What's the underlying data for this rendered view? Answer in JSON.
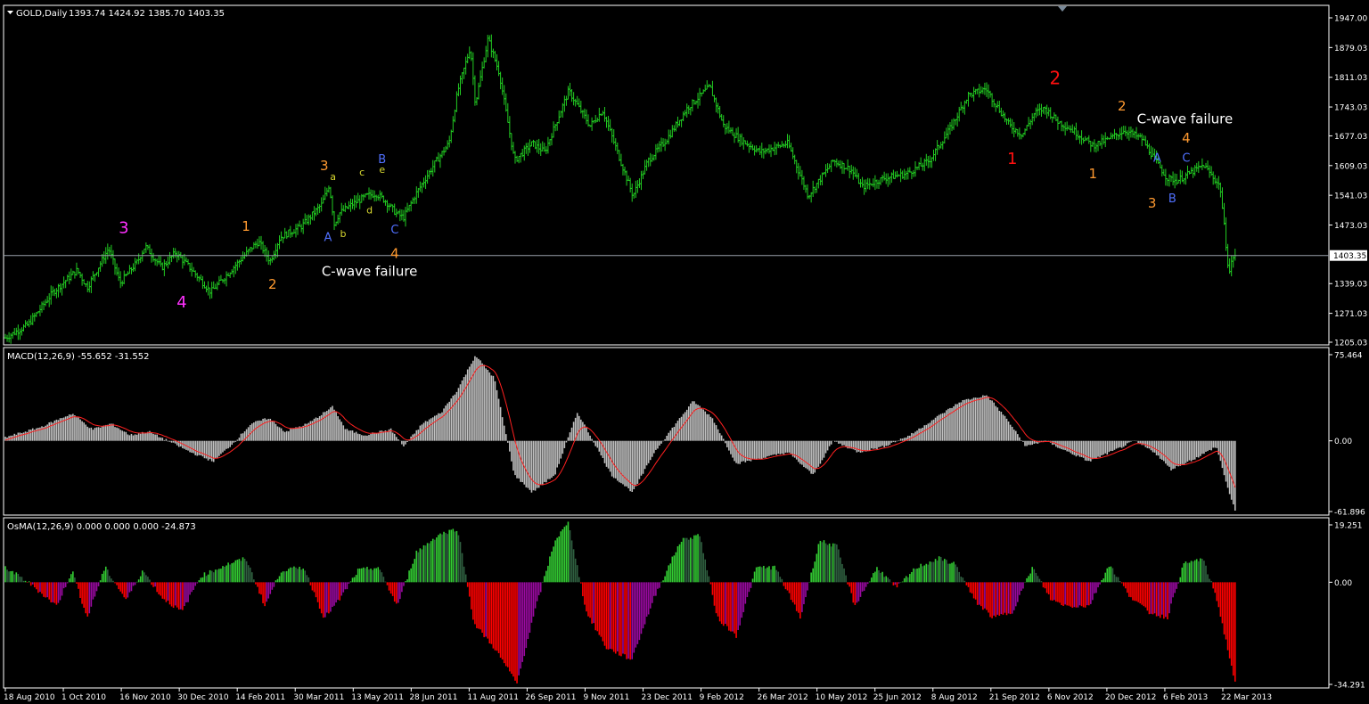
{
  "header": {
    "symbol": "GOLD,Daily",
    "ohlc": "1393.74 1424.92 1385.70 1403.35"
  },
  "colors": {
    "background": "#000000",
    "frame": "#ffffff",
    "bull_bar": "#22cc22",
    "macd_hist": "#c0c0c0",
    "macd_signal": "#ff2020",
    "osma_up_bright": "#33cc33",
    "osma_up_dark": "#2f6040",
    "osma_down_red": "#ff0000",
    "osma_down_purple": "#9a0aa0",
    "price_line": "#9aa0aa",
    "wave_magenta": "#ff30ff",
    "wave_orange": "#ff9a30",
    "wave_blue": "#5070ff",
    "wave_yellow": "#d8d830",
    "wave_red": "#ff1010",
    "annotation_text": "#ffffff"
  },
  "chart_data": [
    {
      "type": "bar",
      "subtype": "ohlc",
      "title": "GOLD,Daily",
      "ohlc_readout": {
        "open": 1393.74,
        "high": 1424.92,
        "low": 1385.7,
        "close": 1403.35
      },
      "current_price": 1403.35,
      "current_price_label": "1403.35",
      "ylim": [
        1205.0,
        1947.0
      ],
      "y_ticks": [
        "1947.00",
        "1879.03",
        "1811.03",
        "1743.03",
        "1677.03",
        "1609.03",
        "1541.03",
        "1473.03",
        "1339.03",
        "1271.03",
        "1205.03"
      ],
      "x_ticks": [
        "18 Aug 2010",
        "1 Oct 2010",
        "16 Nov 2010",
        "30 Dec 2010",
        "14 Feb 2011",
        "30 Mar 2011",
        "13 May 2011",
        "28 Jun 2011",
        "11 Aug 2011",
        "26 Sep 2011",
        "9 Nov 2011",
        "23 Dec 2011",
        "9 Feb 2012",
        "26 Mar 2012",
        "10 May 2012",
        "25 Jun 2012",
        "8 Aug 2012",
        "21 Sep 2012",
        "6 Nov 2012",
        "20 Dec 2012",
        "6 Feb 2013",
        "22 Mar 2013"
      ],
      "price_path": [
        [
          "2010-08-18",
          1215
        ],
        [
          "2010-09-05",
          1245
        ],
        [
          "2010-09-25",
          1320
        ],
        [
          "2010-10-14",
          1370
        ],
        [
          "2010-10-22",
          1330
        ],
        [
          "2010-11-08",
          1420
        ],
        [
          "2010-11-17",
          1340
        ],
        [
          "2010-12-01",
          1390
        ],
        [
          "2010-12-07",
          1425
        ],
        [
          "2010-12-20",
          1375
        ],
        [
          "2010-12-31",
          1410
        ],
        [
          "2011-01-10",
          1380
        ],
        [
          "2011-01-28",
          1320
        ],
        [
          "2011-02-10",
          1360
        ],
        [
          "2011-03-01",
          1420
        ],
        [
          "2011-03-07",
          1435
        ],
        [
          "2011-03-16",
          1390
        ],
        [
          "2011-03-24",
          1445
        ],
        [
          "2011-04-10",
          1470
        ],
        [
          "2011-04-26",
          1520
        ],
        [
          "2011-05-02",
          1565
        ],
        [
          "2011-05-06",
          1475
        ],
        [
          "2011-05-10",
          1500
        ],
        [
          "2011-05-20",
          1520
        ],
        [
          "2011-06-01",
          1540
        ],
        [
          "2011-06-08",
          1545
        ],
        [
          "2011-06-15",
          1530
        ],
        [
          "2011-06-24",
          1500
        ],
        [
          "2011-06-30",
          1490
        ],
        [
          "2011-07-10",
          1545
        ],
        [
          "2011-07-25",
          1615
        ],
        [
          "2011-08-05",
          1660
        ],
        [
          "2011-08-12",
          1780
        ],
        [
          "2011-08-22",
          1880
        ],
        [
          "2011-08-26",
          1750
        ],
        [
          "2011-09-05",
          1900
        ],
        [
          "2011-09-14",
          1820
        ],
        [
          "2011-09-26",
          1620
        ],
        [
          "2011-10-10",
          1660
        ],
        [
          "2011-10-20",
          1640
        ],
        [
          "2011-11-08",
          1780
        ],
        [
          "2011-11-25",
          1700
        ],
        [
          "2011-12-05",
          1735
        ],
        [
          "2011-12-29",
          1540
        ],
        [
          "2012-01-10",
          1620
        ],
        [
          "2012-01-25",
          1670
        ],
        [
          "2012-02-10",
          1740
        ],
        [
          "2012-02-28",
          1790
        ],
        [
          "2012-03-10",
          1700
        ],
        [
          "2012-03-25",
          1665
        ],
        [
          "2012-04-08",
          1640
        ],
        [
          "2012-04-30",
          1660
        ],
        [
          "2012-05-16",
          1540
        ],
        [
          "2012-06-05",
          1620
        ],
        [
          "2012-06-19",
          1600
        ],
        [
          "2012-06-28",
          1560
        ],
        [
          "2012-07-15",
          1580
        ],
        [
          "2012-08-02",
          1590
        ],
        [
          "2012-08-20",
          1620
        ],
        [
          "2012-09-05",
          1690
        ],
        [
          "2012-09-20",
          1770
        ],
        [
          "2012-10-04",
          1785
        ],
        [
          "2012-10-23",
          1700
        ],
        [
          "2012-11-02",
          1680
        ],
        [
          "2012-11-12",
          1730
        ],
        [
          "2012-11-20",
          1740
        ],
        [
          "2012-11-30",
          1710
        ],
        [
          "2012-12-12",
          1690
        ],
        [
          "2012-12-28",
          1655
        ],
        [
          "2013-01-10",
          1670
        ],
        [
          "2013-01-22",
          1690
        ],
        [
          "2013-02-05",
          1670
        ],
        [
          "2013-02-18",
          1610
        ],
        [
          "2013-02-25",
          1580
        ],
        [
          "2013-03-05",
          1575
        ],
        [
          "2013-03-20",
          1600
        ],
        [
          "2013-03-26",
          1610
        ],
        [
          "2013-04-03",
          1580
        ],
        [
          "2013-04-08",
          1560
        ],
        [
          "2013-04-15",
          1360
        ],
        [
          "2013-04-18",
          1400
        ],
        [
          "2013-04-20",
          1403
        ]
      ],
      "annotations": [
        {
          "text": "3",
          "color": "wave_magenta",
          "date": "2010-11-20",
          "price": 1455,
          "size": 18
        },
        {
          "text": "4",
          "color": "wave_magenta",
          "date": "2011-01-05",
          "price": 1285,
          "size": 18
        },
        {
          "text": "1",
          "color": "wave_orange",
          "date": "2011-02-25",
          "price": 1460,
          "size": 15
        },
        {
          "text": "2",
          "color": "wave_orange",
          "date": "2011-03-18",
          "price": 1327,
          "size": 15
        },
        {
          "text": "3",
          "color": "wave_orange",
          "date": "2011-04-28",
          "price": 1598,
          "size": 15
        },
        {
          "text": "a",
          "color": "wave_yellow",
          "date": "2011-05-05",
          "price": 1576,
          "size": 11
        },
        {
          "text": "A",
          "color": "wave_blue",
          "date": "2011-05-01",
          "price": 1436,
          "size": 13
        },
        {
          "text": "b",
          "color": "wave_yellow",
          "date": "2011-05-13",
          "price": 1446,
          "size": 11
        },
        {
          "text": "c",
          "color": "wave_yellow",
          "date": "2011-05-28",
          "price": 1586,
          "size": 11
        },
        {
          "text": "d",
          "color": "wave_yellow",
          "date": "2011-06-03",
          "price": 1500,
          "size": 11
        },
        {
          "text": "e",
          "color": "wave_yellow",
          "date": "2011-06-13",
          "price": 1592,
          "size": 11
        },
        {
          "text": "B",
          "color": "wave_blue",
          "date": "2011-06-13",
          "price": 1615,
          "size": 13
        },
        {
          "text": "C",
          "color": "wave_blue",
          "date": "2011-06-23",
          "price": 1454,
          "size": 13
        },
        {
          "text": "4",
          "color": "wave_orange",
          "date": "2011-06-23",
          "price": 1398,
          "size": 15
        },
        {
          "text": "C-wave failure",
          "color": "annotation_text",
          "date": "2011-06-03",
          "price": 1357,
          "size": 15
        },
        {
          "text": "1",
          "color": "wave_red",
          "date": "2012-10-25",
          "price": 1613,
          "size": 18
        },
        {
          "text": "2",
          "color": "wave_red",
          "date": "2012-11-28",
          "price": 1795,
          "size": 20
        },
        {
          "text": "1",
          "color": "wave_orange",
          "date": "2012-12-28",
          "price": 1580,
          "size": 15
        },
        {
          "text": "2",
          "color": "wave_orange",
          "date": "2013-01-20",
          "price": 1735,
          "size": 15
        },
        {
          "text": "A",
          "color": "wave_blue",
          "date": "2013-02-17",
          "price": 1618,
          "size": 13
        },
        {
          "text": "3",
          "color": "wave_orange",
          "date": "2013-02-13",
          "price": 1513,
          "size": 15
        },
        {
          "text": "B",
          "color": "wave_blue",
          "date": "2013-03-01",
          "price": 1525,
          "size": 13
        },
        {
          "text": "C",
          "color": "wave_blue",
          "date": "2013-03-12",
          "price": 1618,
          "size": 13
        },
        {
          "text": "4",
          "color": "wave_orange",
          "date": "2013-03-12",
          "price": 1662,
          "size": 15
        },
        {
          "text": "C-wave failure",
          "color": "annotation_text",
          "date": "2013-03-11",
          "price": 1705,
          "size": 15
        }
      ]
    },
    {
      "type": "bar",
      "title": "MACD(12,26,9) -55.652 -31.552",
      "params": "12,26,9",
      "last_main": -55.652,
      "last_signal": -31.552,
      "ylim": [
        -61.896,
        75.464
      ],
      "y_ticks": [
        "75.464",
        "0.00",
        "-61.896"
      ],
      "histogram_path": [
        [
          "2010-08-18",
          3
        ],
        [
          "2010-09-15",
          12
        ],
        [
          "2010-10-10",
          24
        ],
        [
          "2010-10-26",
          10
        ],
        [
          "2010-11-10",
          15
        ],
        [
          "2010-11-25",
          5
        ],
        [
          "2010-12-10",
          8
        ],
        [
          "2010-12-25",
          0
        ],
        [
          "2011-01-12",
          -10
        ],
        [
          "2011-01-30",
          -18
        ],
        [
          "2011-02-15",
          -2
        ],
        [
          "2011-03-01",
          15
        ],
        [
          "2011-03-15",
          20
        ],
        [
          "2011-03-28",
          8
        ],
        [
          "2011-04-15",
          15
        ],
        [
          "2011-05-05",
          30
        ],
        [
          "2011-05-15",
          10
        ],
        [
          "2011-05-30",
          5
        ],
        [
          "2011-06-20",
          10
        ],
        [
          "2011-06-30",
          -5
        ],
        [
          "2011-07-15",
          15
        ],
        [
          "2011-07-30",
          25
        ],
        [
          "2011-08-12",
          45
        ],
        [
          "2011-08-26",
          75
        ],
        [
          "2011-09-10",
          55
        ],
        [
          "2011-09-26",
          -30
        ],
        [
          "2011-10-10",
          -45
        ],
        [
          "2011-10-28",
          -30
        ],
        [
          "2011-11-15",
          25
        ],
        [
          "2011-11-30",
          -5
        ],
        [
          "2011-12-12",
          -30
        ],
        [
          "2011-12-29",
          -45
        ],
        [
          "2012-01-15",
          -10
        ],
        [
          "2012-02-01",
          15
        ],
        [
          "2012-02-15",
          35
        ],
        [
          "2012-03-01",
          20
        ],
        [
          "2012-03-20",
          -20
        ],
        [
          "2012-04-10",
          -15
        ],
        [
          "2012-04-30",
          -10
        ],
        [
          "2012-05-20",
          -30
        ],
        [
          "2012-06-05",
          0
        ],
        [
          "2012-06-25",
          -10
        ],
        [
          "2012-07-15",
          -5
        ],
        [
          "2012-08-05",
          5
        ],
        [
          "2012-08-25",
          20
        ],
        [
          "2012-09-15",
          35
        ],
        [
          "2012-10-05",
          40
        ],
        [
          "2012-10-20",
          20
        ],
        [
          "2012-11-05",
          -5
        ],
        [
          "2012-11-20",
          0
        ],
        [
          "2012-12-05",
          -8
        ],
        [
          "2012-12-25",
          -18
        ],
        [
          "2013-01-15",
          -8
        ],
        [
          "2013-01-30",
          0
        ],
        [
          "2013-02-15",
          -10
        ],
        [
          "2013-02-28",
          -25
        ],
        [
          "2013-03-20",
          -15
        ],
        [
          "2013-04-05",
          -5
        ],
        [
          "2013-04-15",
          -45
        ],
        [
          "2013-04-20",
          -62
        ]
      ]
    },
    {
      "type": "bar",
      "title": "OsMA(12,26,9) 0.000 0.000 0.000 -24.873",
      "params": "12,26,9",
      "last_value": -24.873,
      "ylim": [
        -34.291,
        19.251
      ],
      "y_ticks": [
        "19.251",
        "0.00",
        "-34.291"
      ],
      "histogram_path": [
        [
          "2010-08-18",
          5
        ],
        [
          "2010-09-05",
          0
        ],
        [
          "2010-09-28",
          -8
        ],
        [
          "2010-10-10",
          4
        ],
        [
          "2010-10-22",
          -12
        ],
        [
          "2010-11-05",
          5
        ],
        [
          "2010-11-22",
          -6
        ],
        [
          "2010-12-05",
          4
        ],
        [
          "2010-12-20",
          -5
        ],
        [
          "2011-01-05",
          -10
        ],
        [
          "2011-01-20",
          2
        ],
        [
          "2011-02-10",
          6
        ],
        [
          "2011-02-25",
          8
        ],
        [
          "2011-03-12",
          -8
        ],
        [
          "2011-03-25",
          4
        ],
        [
          "2011-04-12",
          5
        ],
        [
          "2011-04-28",
          -12
        ],
        [
          "2011-05-10",
          -6
        ],
        [
          "2011-05-25",
          4
        ],
        [
          "2011-06-10",
          5
        ],
        [
          "2011-06-25",
          -8
        ],
        [
          "2011-07-10",
          10
        ],
        [
          "2011-07-28",
          16
        ],
        [
          "2011-08-12",
          18
        ],
        [
          "2011-08-25",
          -14
        ],
        [
          "2011-09-10",
          -22
        ],
        [
          "2011-09-28",
          -34
        ],
        [
          "2011-10-12",
          -10
        ],
        [
          "2011-10-28",
          14
        ],
        [
          "2011-11-08",
          20
        ],
        [
          "2011-11-22",
          -10
        ],
        [
          "2011-12-08",
          -22
        ],
        [
          "2011-12-28",
          -26
        ],
        [
          "2012-01-15",
          -5
        ],
        [
          "2012-02-05",
          14
        ],
        [
          "2012-02-20",
          16
        ],
        [
          "2012-03-05",
          -12
        ],
        [
          "2012-03-20",
          -18
        ],
        [
          "2012-04-05",
          5
        ],
        [
          "2012-04-20",
          5
        ],
        [
          "2012-05-10",
          -12
        ],
        [
          "2012-05-25",
          14
        ],
        [
          "2012-06-08",
          12
        ],
        [
          "2012-06-22",
          -8
        ],
        [
          "2012-07-10",
          5
        ],
        [
          "2012-07-25",
          -2
        ],
        [
          "2012-08-10",
          5
        ],
        [
          "2012-08-28",
          8
        ],
        [
          "2012-09-10",
          6
        ],
        [
          "2012-09-25",
          -6
        ],
        [
          "2012-10-10",
          -12
        ],
        [
          "2012-10-25",
          -10
        ],
        [
          "2012-11-10",
          5
        ],
        [
          "2012-11-25",
          -6
        ],
        [
          "2012-12-08",
          -8
        ],
        [
          "2012-12-25",
          -8
        ],
        [
          "2013-01-10",
          6
        ],
        [
          "2013-01-25",
          -4
        ],
        [
          "2013-02-10",
          -10
        ],
        [
          "2013-02-25",
          -12
        ],
        [
          "2013-03-10",
          6
        ],
        [
          "2013-03-25",
          8
        ],
        [
          "2013-04-05",
          -5
        ],
        [
          "2013-04-20",
          -34
        ]
      ]
    }
  ]
}
